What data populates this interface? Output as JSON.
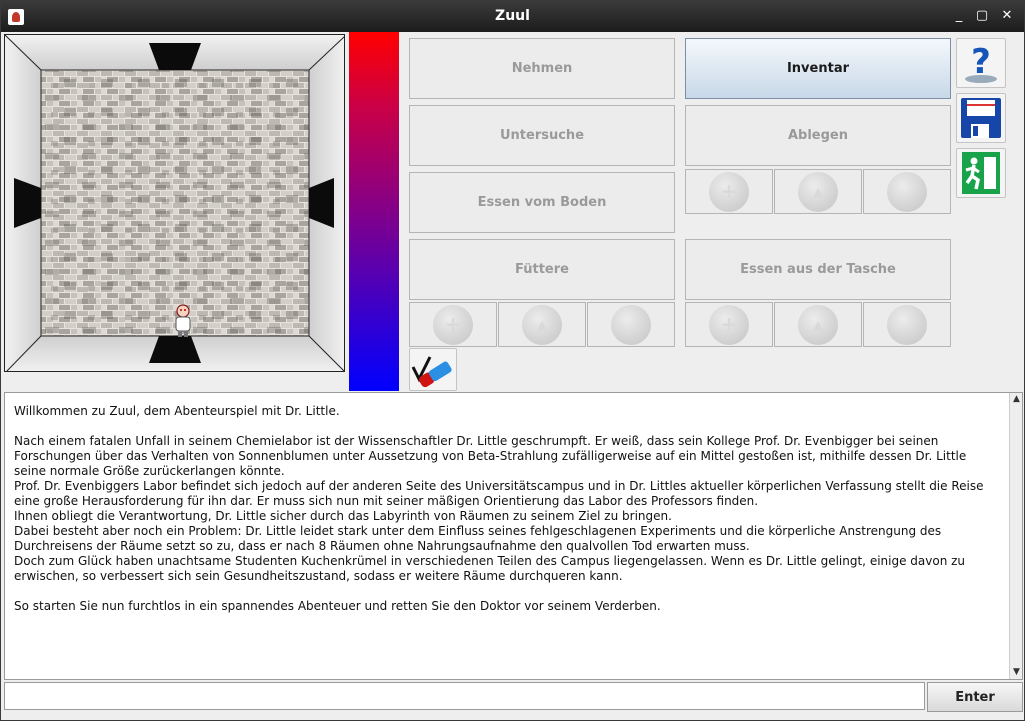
{
  "window": {
    "title": "Zuul"
  },
  "controls": {
    "take_label": "Nehmen",
    "inventory_label": "Inventar",
    "examine_label": "Untersuche",
    "drop_label": "Ablegen",
    "eat_from_floor_label": "Essen vom Boden",
    "feed_label": "Füttere",
    "eat_from_bag_label": "Essen aus der Tasche"
  },
  "log": {
    "text": "Willkommen zu Zuul, dem Abenteurspiel mit Dr. Little.\n\nNach einem fatalen Unfall in seinem Chemielabor ist der Wissenschaftler Dr. Little geschrumpft. Er weiß, dass sein Kollege Prof. Dr. Evenbigger bei seinen Forschungen über das Verhalten von Sonnenblumen unter Aussetzung von Beta-Strahlung zufälligerweise auf ein Mittel gestoßen ist, mithilfe dessen Dr. Little seine normale Größe zurückerlangen könnte.\nProf. Dr. Evenbiggers Labor befindet sich jedoch auf der anderen Seite des Universitätscampus und in Dr. Littles aktueller körperlichen Verfassung stellt die Reise eine große Herausforderung für ihn dar. Er muss sich nun mit seiner mäßigen Orientierung das Labor des Professors finden.\nIhnen obliegt die Verantwortung, Dr. Little sicher durch das Labyrinth von Räumen zu seinem Ziel zu bringen.\nDabei besteht aber noch ein Problem: Dr. Little leidet stark unter dem Einfluss seines fehlgeschlagenen Experiments und die körperliche Anstrengung des Durchreisens der Räume setzt so zu, dass er nach 8 Räumen ohne Nahrungsaufnahme den qualvollen Tod erwarten muss.\nDoch zum Glück haben unachtsame Studenten Kuchenkrümel in verschiedenen Teilen des Campus liegengelassen. Wenn es Dr. Little gelingt, einige davon zu erwischen, so verbessert sich sein Gesundheitszustand, sodass er weitere Räume durchqueren kann.\n\nSo starten Sie nun furchtlos in ein spannendes Abenteuer und retten Sie den Doktor vor seinem Verderben."
  },
  "input": {
    "value": "",
    "enter_label": "Enter"
  },
  "colors": {
    "health_top": "#ff0000",
    "health_bottom": "#0000ff",
    "active_button": "#c8d8e8"
  },
  "icons": {
    "help": "question-mark-icon",
    "save": "floppy-disk-icon",
    "exit": "exit-sign-icon",
    "item": "eraser-icon"
  }
}
